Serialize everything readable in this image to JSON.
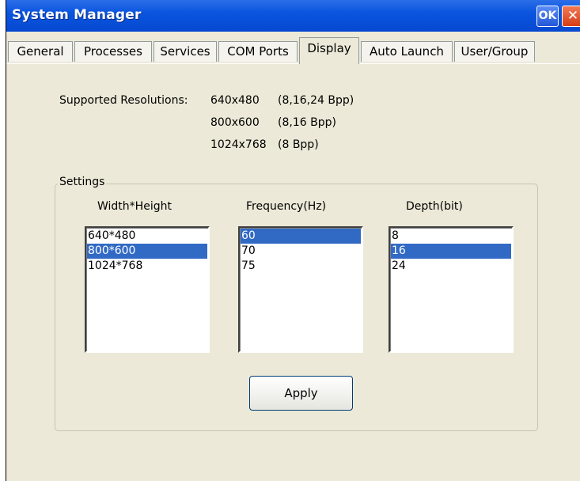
{
  "window": {
    "title": "System Manager",
    "ok_label": "OK",
    "close_label": "✕"
  },
  "tabs": [
    {
      "label": "General"
    },
    {
      "label": "Processes"
    },
    {
      "label": "Services"
    },
    {
      "label": "COM Ports"
    },
    {
      "label": "Display",
      "active": true
    },
    {
      "label": "Auto Launch"
    },
    {
      "label": "User/Group"
    }
  ],
  "display": {
    "supported_label": "Supported Resolutions:",
    "resolutions": [
      {
        "res": "640x480",
        "depth": "(8,16,24 Bpp)"
      },
      {
        "res": "800x600",
        "depth": "(8,16 Bpp)"
      },
      {
        "res": "1024x768",
        "depth": "(8 Bpp)"
      }
    ],
    "settings": {
      "legend": "Settings",
      "width_height": {
        "header": "Width*Height",
        "items": [
          "640*480",
          "800*600",
          "1024*768"
        ],
        "selected": "800*600"
      },
      "frequency": {
        "header": "Frequency(Hz)",
        "items": [
          "60",
          "70",
          "75"
        ],
        "selected": "60"
      },
      "depth": {
        "header": "Depth(bit)",
        "items": [
          "8",
          "16",
          "24"
        ],
        "selected": "16"
      }
    },
    "apply_label": "Apply"
  },
  "colors": {
    "titlebar": "#0a55df",
    "selection": "#316ac5",
    "dialog_bg": "#ece9d8"
  }
}
